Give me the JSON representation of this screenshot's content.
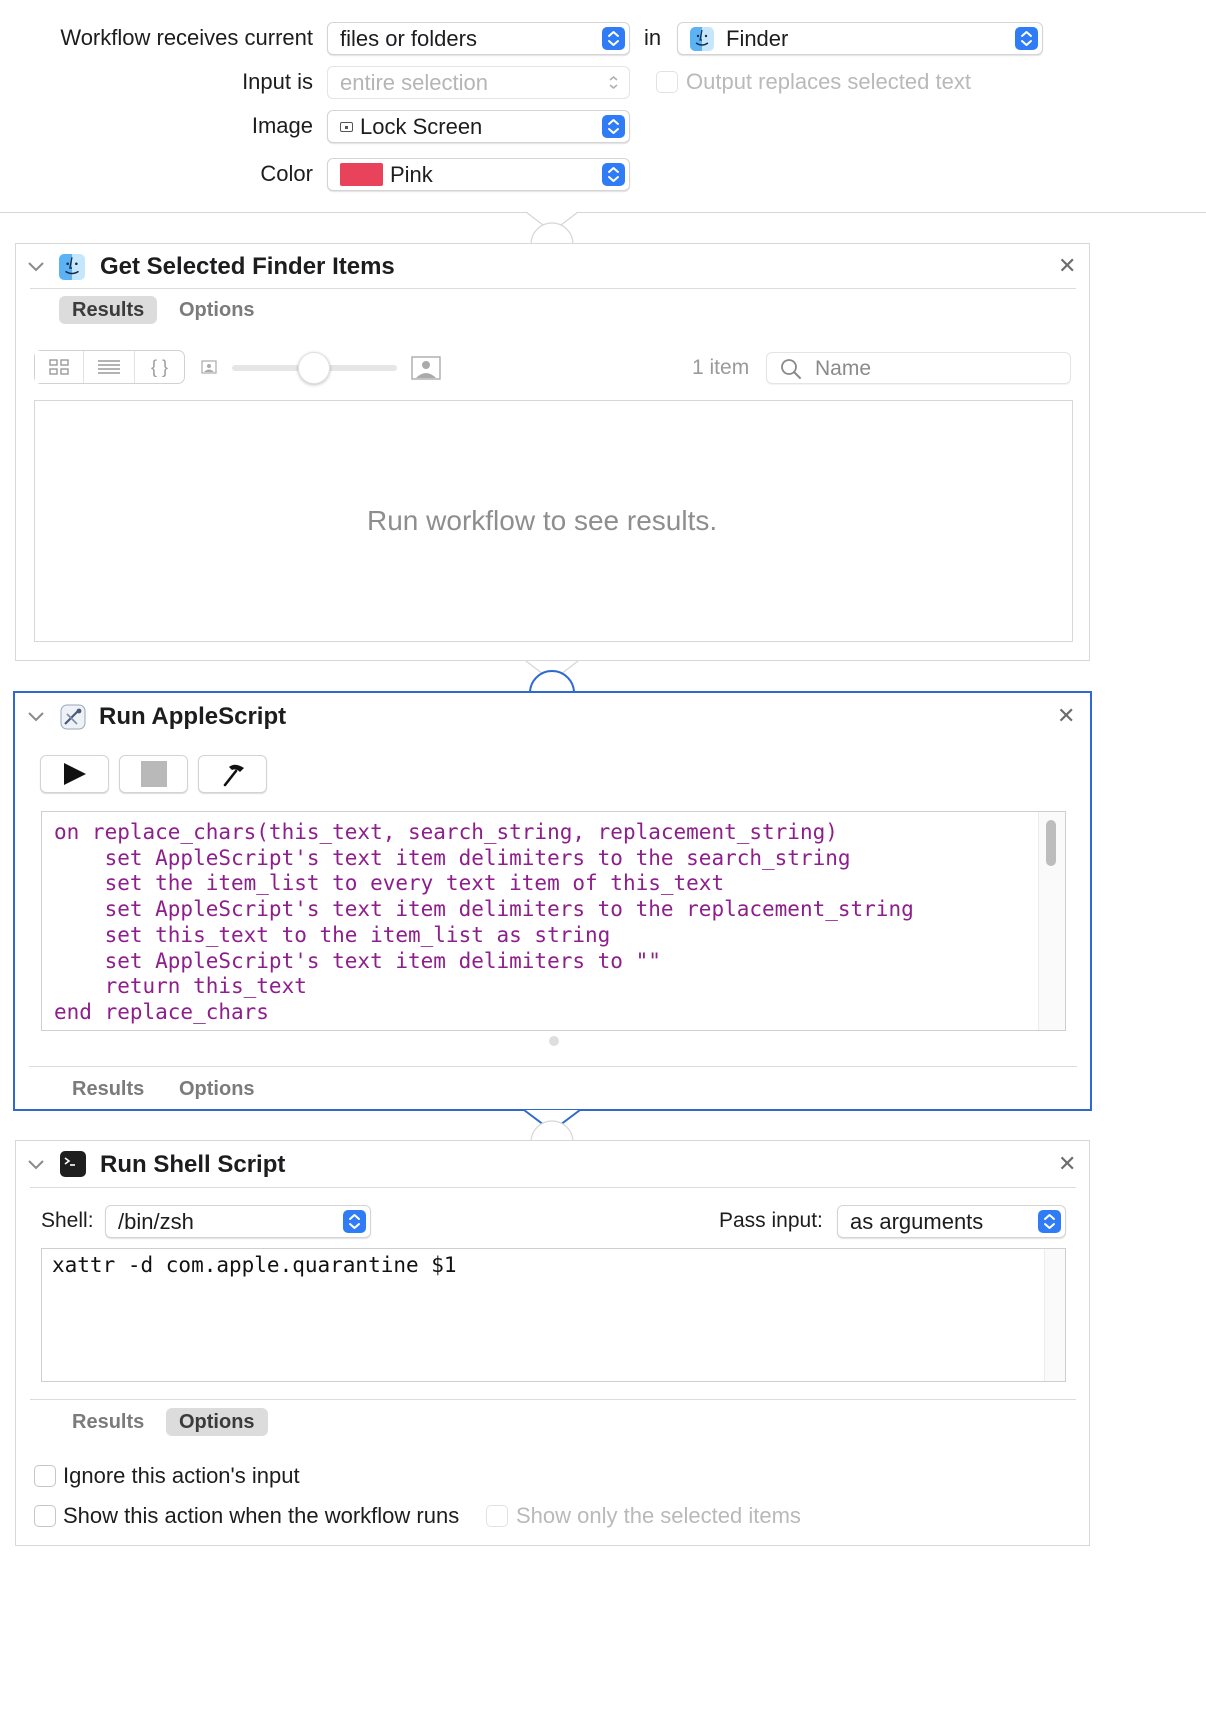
{
  "header": {
    "receives_label": "Workflow receives current",
    "receives_value": "files or folders",
    "in_label": "in",
    "app_value": "Finder",
    "input_label": "Input is",
    "input_value": "entire selection",
    "output_replaces_label": "Output replaces selected text",
    "image_label": "Image",
    "image_value": "Lock Screen",
    "color_label": "Color",
    "color_value": "Pink",
    "color_swatch": "#e8435b"
  },
  "actions": {
    "finder": {
      "title": "Get Selected Finder Items",
      "tabs": {
        "results": "Results",
        "options": "Options"
      },
      "item_count": "1 item",
      "search_placeholder": "Name",
      "empty_message": "Run workflow to see results."
    },
    "applescript": {
      "title": "Run AppleScript",
      "code_lines": [
        "on replace_chars(this_text, search_string, replacement_string)",
        "    set AppleScript's text item delimiters to the search_string",
        "    set the item_list to every text item of this_text",
        "    set AppleScript's text item delimiters to the replacement_string",
        "    set this_text to the item_list as string",
        "    set AppleScript's text item delimiters to \"\"",
        "    return this_text",
        "end replace_chars"
      ],
      "tabs": {
        "results": "Results",
        "options": "Options"
      }
    },
    "shell": {
      "title": "Run Shell Script",
      "shell_label": "Shell:",
      "shell_value": "/bin/zsh",
      "pass_input_label": "Pass input:",
      "pass_input_value": "as arguments",
      "code": "xattr -d com.apple.quarantine $1",
      "tabs": {
        "results": "Results",
        "options": "Options"
      },
      "ignore_input_label": "Ignore this action's input",
      "show_action_label": "Show this action when the workflow runs",
      "show_selected_label": "Show only the selected items"
    }
  },
  "colors": {
    "accent": "#2f7cf6",
    "selected_border": "#2f68d0",
    "code_purple": "#8e1e8c"
  },
  "icons": {
    "finder": "finder-icon",
    "applescript": "script-editor-icon",
    "terminal": "terminal-icon",
    "close": "close-icon",
    "disclosure": "chevron-down-icon"
  }
}
